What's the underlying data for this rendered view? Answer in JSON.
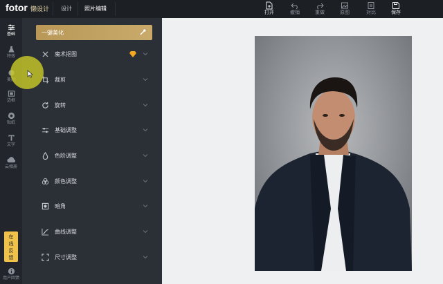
{
  "topbar": {
    "logo": "fotor",
    "logo_sub": "懒设计",
    "nav": [
      "设计",
      "照片编辑"
    ],
    "actions": [
      {
        "label": "打开",
        "icon": "open-file-icon",
        "enabled": true
      },
      {
        "label": "撤销",
        "icon": "undo-icon",
        "enabled": false
      },
      {
        "label": "重做",
        "icon": "redo-icon",
        "enabled": false
      },
      {
        "label": "原图",
        "icon": "original-image-icon",
        "enabled": false
      },
      {
        "label": "对比",
        "icon": "compare-icon",
        "enabled": false
      },
      {
        "label": "保存",
        "icon": "save-icon",
        "enabled": true
      }
    ]
  },
  "rail": {
    "items": [
      {
        "label": "基础",
        "icon": "sliders-icon"
      },
      {
        "label": "特效",
        "icon": "flask-icon"
      },
      {
        "label": "美颜",
        "icon": "face-icon"
      },
      {
        "label": "边框",
        "icon": "frame-icon"
      },
      {
        "label": "贴纸",
        "icon": "sticker-icon"
      },
      {
        "label": "文字",
        "icon": "text-icon"
      },
      {
        "label": "云相册",
        "icon": "cloud-icon"
      }
    ],
    "feedback": [
      "在",
      "线",
      "反",
      "馈"
    ],
    "user_feedback": "用户回馈"
  },
  "panel": {
    "top_button": "一键美化",
    "rows": [
      {
        "label": "魔术抠图",
        "icon": "scissors-icon",
        "premium": true
      },
      {
        "label": "裁剪",
        "icon": "crop-icon",
        "premium": false
      },
      {
        "label": "旋转",
        "icon": "rotate-icon",
        "premium": false
      },
      {
        "label": "基础调整",
        "icon": "adjust-icon",
        "premium": false
      },
      {
        "label": "色阶调整",
        "icon": "drop-icon",
        "premium": false
      },
      {
        "label": "颜色调整",
        "icon": "color-circles-icon",
        "premium": false
      },
      {
        "label": "暗角",
        "icon": "vignette-icon",
        "premium": false
      },
      {
        "label": "曲线调整",
        "icon": "curve-icon",
        "premium": false
      },
      {
        "label": "尺寸调整",
        "icon": "resize-icon",
        "premium": false
      }
    ]
  },
  "colors": {
    "accent_gold": "#c9aa6b",
    "feedback_yellow": "#f0c24a",
    "premium_diamond": "#f5a623"
  }
}
